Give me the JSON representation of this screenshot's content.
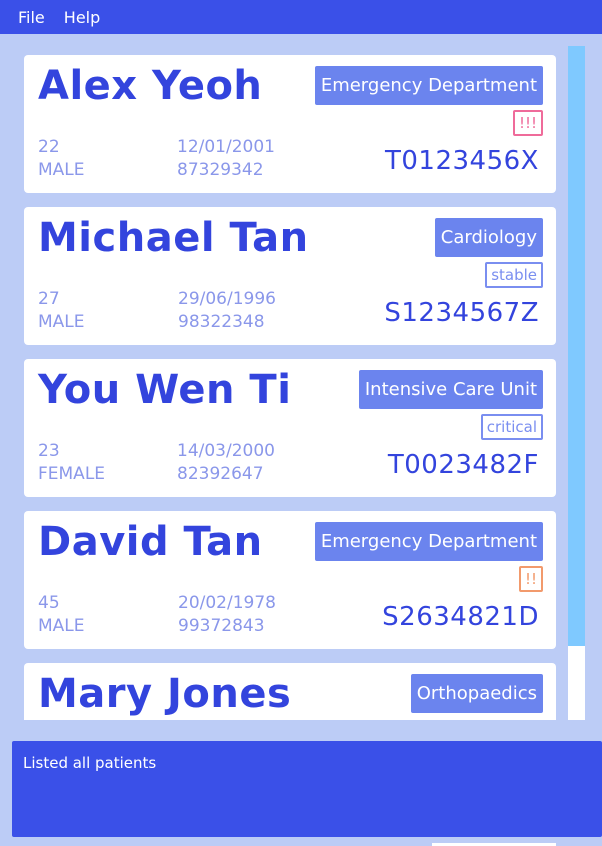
{
  "menu": [
    "File",
    "Help"
  ],
  "patients": [
    {
      "name": "Alex Yeoh",
      "department": "Emergency Department",
      "status": "!!!",
      "status_type": "alert3",
      "age": "22",
      "gender": "MALE",
      "dob": "12/01/2001",
      "phone": "87329342",
      "nric": "T0123456X"
    },
    {
      "name": "Michael Tan",
      "department": "Cardiology",
      "status": "stable",
      "status_type": "normal",
      "age": "27",
      "gender": "MALE",
      "dob": "29/06/1996",
      "phone": "98322348",
      "nric": "S1234567Z"
    },
    {
      "name": "You Wen Ti",
      "department": "Intensive Care Unit",
      "status": "critical",
      "status_type": "normal",
      "age": "23",
      "gender": "FEMALE",
      "dob": "14/03/2000",
      "phone": "82392647",
      "nric": "T0023482F"
    },
    {
      "name": "David Tan",
      "department": "Emergency Department",
      "status": "!!",
      "status_type": "alert2",
      "age": "45",
      "gender": "MALE",
      "dob": "20/02/1978",
      "phone": "99372843",
      "nric": "S2634821D"
    },
    {
      "name": "Mary Jones",
      "department": "Orthopaedics",
      "status": "",
      "status_type": "normal",
      "age": "",
      "gender": "",
      "dob": "",
      "phone": "",
      "nric": ""
    }
  ],
  "result_message": "Listed all patients",
  "colors": {
    "accent": "#3a50e8",
    "background": "#bcccf6",
    "tag": "#6b84ee",
    "scrollbar": "#7fc9ff"
  }
}
